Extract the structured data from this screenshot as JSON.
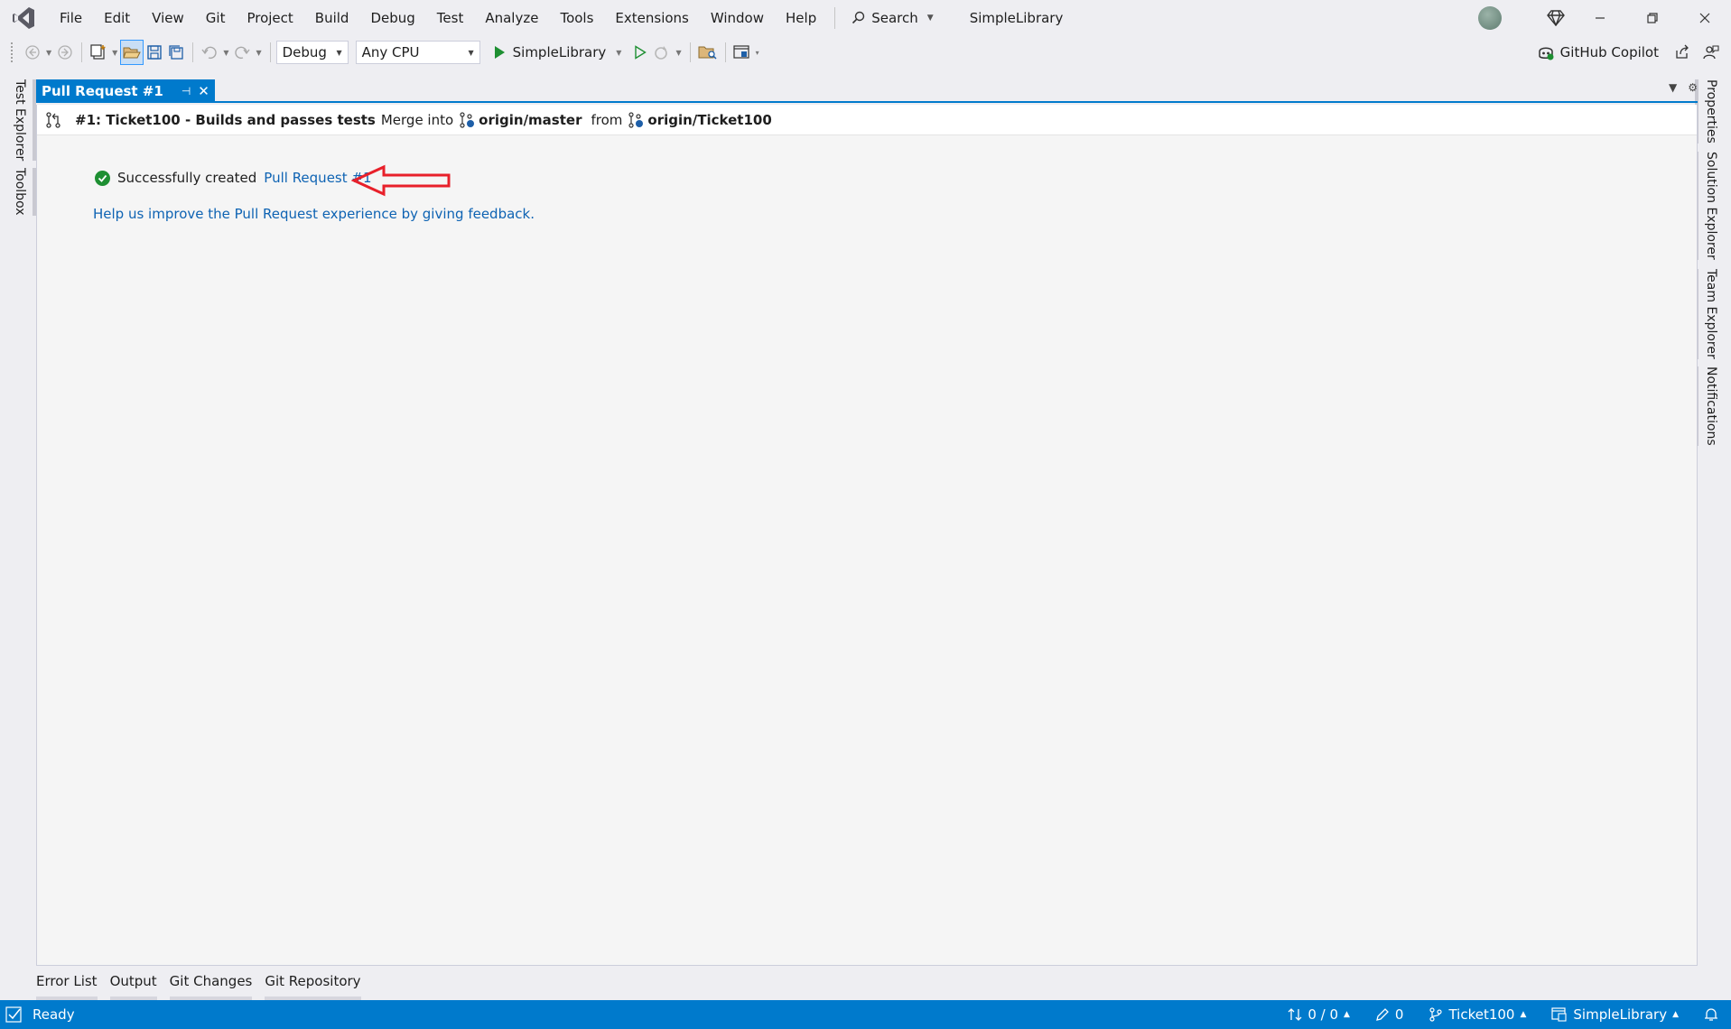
{
  "menu": {
    "items": [
      "File",
      "Edit",
      "View",
      "Git",
      "Project",
      "Build",
      "Debug",
      "Test",
      "Analyze",
      "Tools",
      "Extensions",
      "Window",
      "Help"
    ],
    "search_label": "Search",
    "solution_name": "SimpleLibrary"
  },
  "toolbar": {
    "config": "Debug",
    "platform": "Any CPU",
    "run_target": "SimpleLibrary",
    "copilot_label": "GitHub Copilot"
  },
  "side_left": {
    "items": [
      "Test Explorer",
      "Toolbox"
    ]
  },
  "side_right": {
    "items": [
      "Properties",
      "Solution Explorer",
      "Team Explorer",
      "Notifications"
    ]
  },
  "doc_tab": {
    "title": "Pull Request #1"
  },
  "pr": {
    "title": "#1: Ticket100 - Builds and passes tests",
    "merge_into": "Merge into",
    "target_branch": "origin/master",
    "from": "from",
    "source_branch": "origin/Ticket100",
    "success_text": "Successfully created",
    "success_link": "Pull Request #1",
    "feedback_link": "Help us improve the Pull Request experience by giving feedback."
  },
  "bottom_tabs": [
    "Error List",
    "Output",
    "Git Changes",
    "Git Repository"
  ],
  "status": {
    "ready": "Ready",
    "sync": "0 / 0",
    "edits": "0",
    "branch": "Ticket100",
    "repo": "SimpleLibrary"
  },
  "colors": {
    "accent": "#007acc",
    "success": "#1e8f32",
    "link": "#0e63b3",
    "annotation_arrow": "#e8202a"
  }
}
